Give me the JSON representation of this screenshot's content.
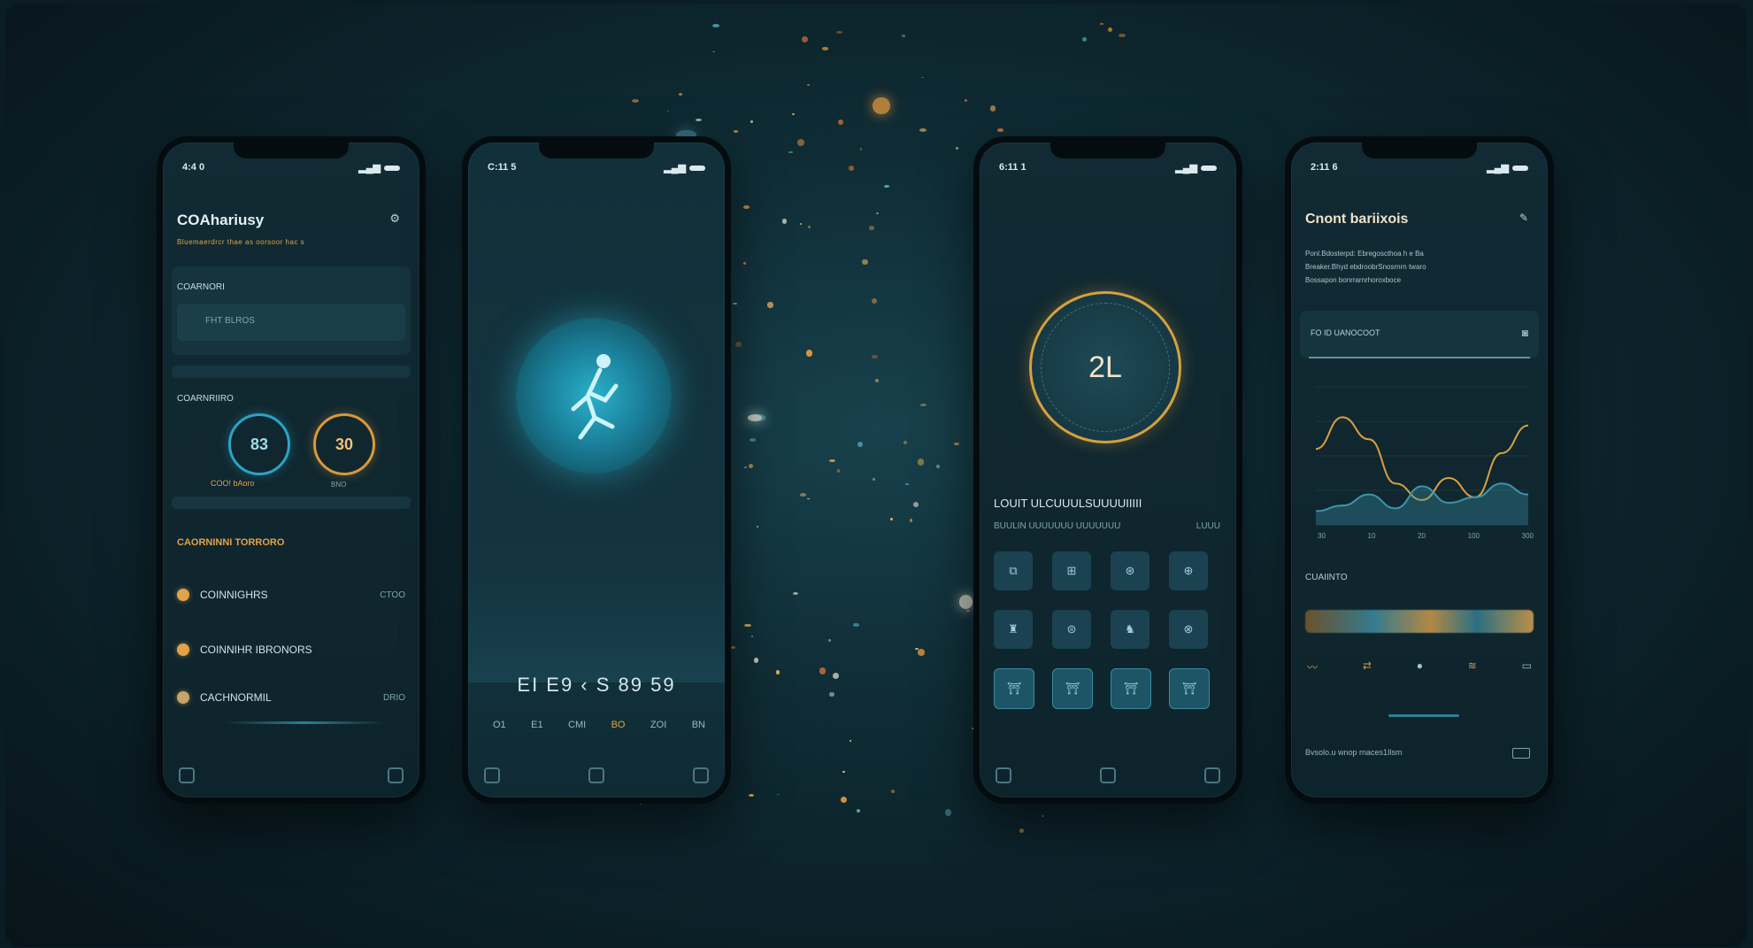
{
  "screen1": {
    "status": {
      "time": "4:4 0"
    },
    "title": "COAhariusy",
    "subtitle": "Bluemaerdrcr thae as oorsoor hac s",
    "section_label": "COARNORI",
    "input_value": "FHT BLROS",
    "goals_label": "COARNRIIRO",
    "ring_blue_value": "83",
    "ring_gold_value": "30",
    "ring_blue_caption": "COO!  bAoro",
    "ring_gold_caption": "BNO",
    "activities_heading": "CAORNINNI TORRORO",
    "items": [
      {
        "label": "COINNIGHRS",
        "value": "CTOO"
      },
      {
        "label": "COINNIHR IBRONORS",
        "value": ""
      },
      {
        "label": "CACHNORMIL",
        "value": "DRIO"
      }
    ]
  },
  "screen2": {
    "status": {
      "time": "C:11 5"
    },
    "readout": "EI  E9 ‹ S   89 59",
    "subreadout": [
      "O1",
      "E1",
      "CMI",
      "BO",
      "ZOI",
      "BN"
    ]
  },
  "screen3": {
    "status": {
      "time": "6:11 1"
    },
    "dial_value": "2L",
    "heading": "LOUIT ULCUUULSUUUUIIIII",
    "subheading": "BUULIN UUUUUUU UUUUUUU",
    "subvalue": "LUUU",
    "tiles_row1": [
      "⧉",
      "⊞",
      "⊛",
      "⊕"
    ],
    "tiles_row2": [
      "♜",
      "⊜",
      "♞",
      "⊗"
    ],
    "tiles_row3": [
      "⛩",
      "⛩",
      "⛩",
      "⛩"
    ]
  },
  "screen4": {
    "status": {
      "time": "2:11 6"
    },
    "title": "Cnont bariixois",
    "desc": [
      "Ponl.Bdosterpd: Ebregoscthoa h e Ba",
      "Breaker.Bhyd ebdroobrSnosrnrn twaro",
      "Bossapon bonrrarnrhoroxboce"
    ],
    "input_label": "FO ID UANOCOOT",
    "xticks": [
      "30",
      "10",
      "20",
      "100",
      "300"
    ],
    "section_label": "CUAIINTO",
    "footer_text": "Bvsolo.u wnop rnaces1Ilsm",
    "chart_data": {
      "type": "line",
      "series": [
        {
          "name": "",
          "color": "#d9a03f",
          "values": [
            55,
            78,
            62,
            30,
            18,
            34,
            20,
            52,
            72
          ]
        },
        {
          "name": "",
          "color": "#3d94ab",
          "values": [
            10,
            14,
            22,
            12,
            28,
            16,
            20,
            30,
            22
          ]
        }
      ],
      "x": [
        1,
        2,
        3,
        4,
        5,
        6,
        7,
        8,
        9
      ],
      "ylim": [
        0,
        100
      ],
      "xlabel": "",
      "ylabel": "",
      "title": ""
    }
  }
}
